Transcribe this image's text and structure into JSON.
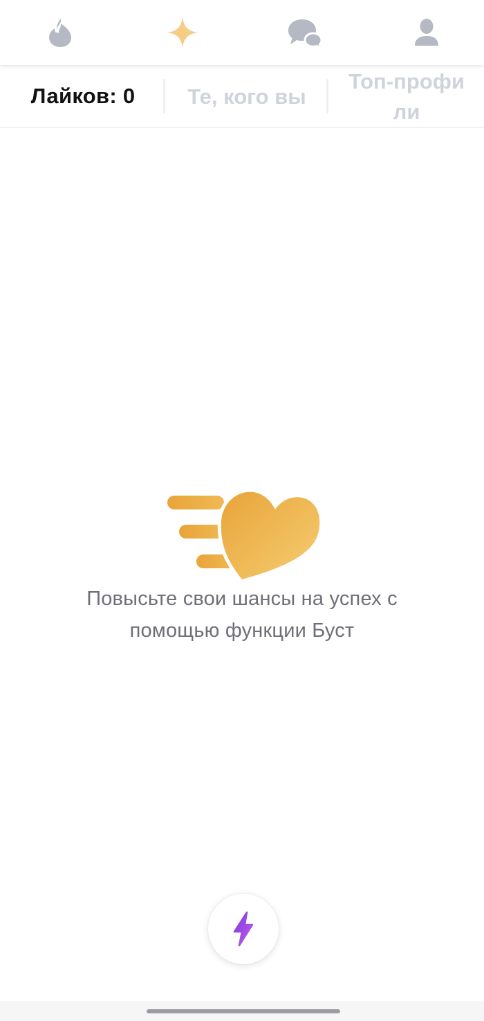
{
  "nav": {
    "items": [
      {
        "icon": "flame-icon",
        "color": "#b5b9c4"
      },
      {
        "icon": "sparkle-icon",
        "color": "#f5cd84",
        "active": true
      },
      {
        "icon": "chat-bubbles-icon",
        "color": "#b5b9c4"
      },
      {
        "icon": "profile-icon",
        "color": "#b5b9c4"
      }
    ]
  },
  "subtabs": {
    "likes": "Лайков: 0",
    "liked_by_you": "Те, кого вы",
    "top_profiles": "Топ-профи ли"
  },
  "empty_state": {
    "icon": "speeding-heart-icon",
    "message": "Повысьте свои шансы на успех с помощью функции Буст"
  },
  "boost": {
    "icon": "lightning-bolt-icon",
    "color": "#a647e9"
  },
  "colors": {
    "accent_gold": "#e9a83c",
    "inactive_icon": "#b5b9c4",
    "inactive_text": "#cfd3dc",
    "text_dark": "#111114",
    "text_muted": "#6e6f77"
  }
}
